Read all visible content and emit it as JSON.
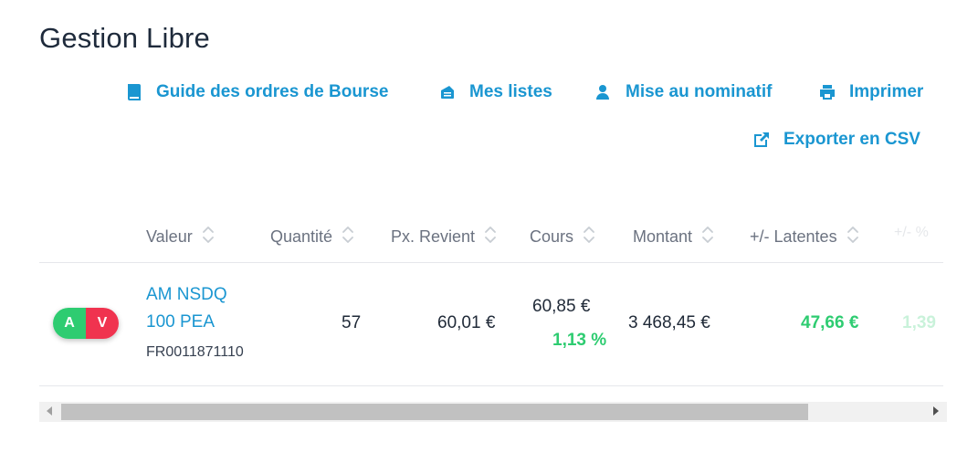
{
  "page": {
    "title": "Gestion Libre"
  },
  "actions": {
    "guide": "Guide des ordres de Bourse",
    "lists": "Mes listes",
    "nominatif": "Mise au nominatif",
    "print": "Imprimer",
    "export": "Exporter en CSV"
  },
  "table": {
    "columns": [
      "Valeur",
      "Quantité",
      "Px. Revient",
      "Cours",
      "Montant",
      "+/- Latentes",
      "+/- %"
    ],
    "rows": [
      {
        "buy_label": "A",
        "sell_label": "V",
        "name_line1": "AM NSDQ",
        "name_line2": "100 PEA",
        "isin": "FR0011871110",
        "quantity": "57",
        "cost_price": "60,01 €",
        "price": "60,85 €",
        "price_change": "1,13 %",
        "amount": "3 468,45 €",
        "unrealized": "47,66 €",
        "unrealized_pct": "1,39"
      }
    ]
  },
  "colors": {
    "accent": "#1a96d1",
    "gain": "#2ecc71",
    "sell": "#f0334f"
  }
}
